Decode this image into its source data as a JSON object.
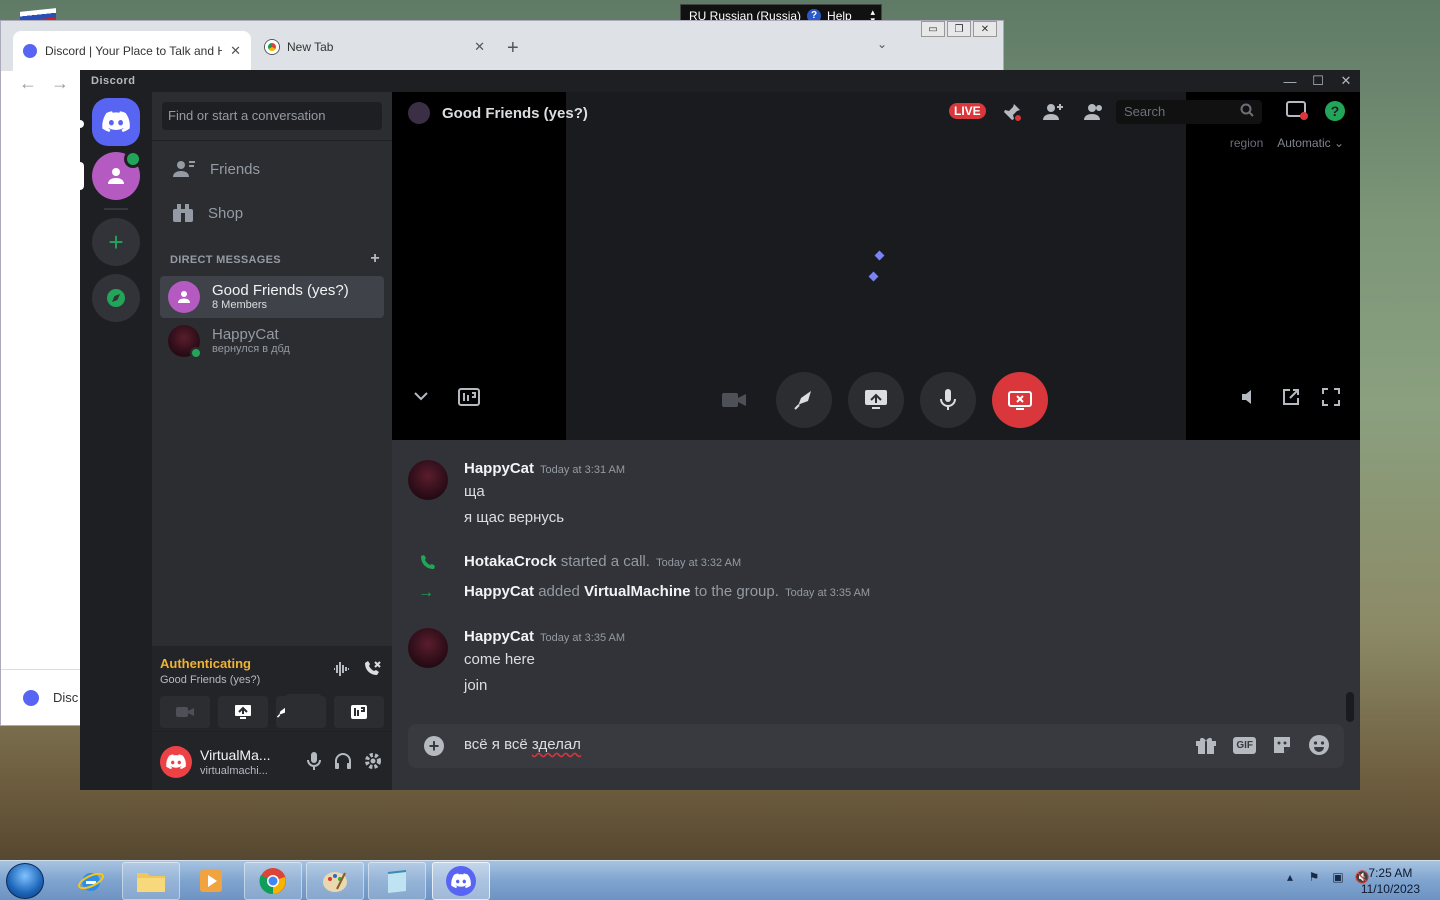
{
  "colors": {
    "discord_blurple": "#5865f2",
    "discord_green": "#23a559",
    "discord_red": "#da373c",
    "authenticating_yellow": "#f0b232"
  },
  "langbar": {
    "lang": "RU Russian (Russia)",
    "help": "Help"
  },
  "browser": {
    "tabs": [
      {
        "title": "Discord | Your Place to Talk and H",
        "icon": "discord-icon"
      },
      {
        "title": "New Tab",
        "icon": "chrome-icon"
      }
    ],
    "side_tab": "Disc"
  },
  "discord": {
    "wordmark": "Discord",
    "search_placeholder": "Find or start a conversation",
    "nav": [
      {
        "label": "Friends",
        "icon": "friends-icon"
      },
      {
        "label": "Shop",
        "icon": "shop-icon"
      }
    ],
    "dm_header": "DIRECT MESSAGES",
    "dms": [
      {
        "name": "Good Friends (yes?)",
        "sub": "8 Members"
      },
      {
        "name": "HappyCat",
        "sub": "вернулся в дбд"
      }
    ],
    "voice": {
      "status": "Authenticating",
      "channel": "Good Friends (yes?)"
    },
    "user": {
      "name": "VirtualMa...",
      "tag": "virtualmachi..."
    },
    "call": {
      "title": "Good Friends (yes?)",
      "live": "LIVE",
      "search": "Search",
      "region_label": "region",
      "region_value": "Automatic"
    },
    "messages": {
      "m1": {
        "author": "HappyCat",
        "time": "Today at 3:31 AM",
        "line1": "ща",
        "line2": "я щас вернусь"
      },
      "sys1": {
        "actor": "HotakaCrock",
        "action": "started a call.",
        "time": "Today at 3:32 AM"
      },
      "sys2": {
        "actor": "HappyCat",
        "verb": "added",
        "target": "VirtualMachine",
        "rest": "to the group.",
        "time": "Today at 3:35 AM"
      },
      "m2": {
        "author": "HappyCat",
        "time": "Today at 3:35 AM",
        "line1": "come here",
        "line2": "join"
      }
    },
    "composer": {
      "text_a": "всё я всё ",
      "text_b": "зделал"
    },
    "gif_label": "GIF"
  },
  "taskbar": {
    "time": "7:25 AM",
    "date": "11/10/2023"
  }
}
